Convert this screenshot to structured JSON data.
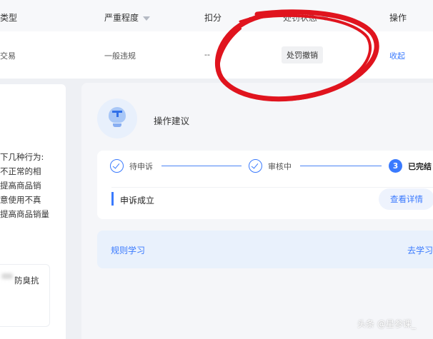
{
  "table": {
    "headers": {
      "type": "类型",
      "severity": "严重程度",
      "score": "扣分",
      "status": "处罚状态",
      "action": "操作"
    },
    "row": {
      "type": "交易",
      "severity": "一般违规",
      "score": "--",
      "status": "处罚撤销",
      "action": "收起"
    }
  },
  "left_panel": {
    "lines": [
      "下几种行为:",
      "不正常的相",
      "提高商品销",
      "意使用不真",
      "提高商品销量"
    ],
    "card_label": "防臭抗"
  },
  "suggestion": {
    "title": "操作建议",
    "steps": [
      {
        "label": "待申诉",
        "state": "done"
      },
      {
        "label": "审核中",
        "state": "done"
      },
      {
        "label": "已完结",
        "state": "current",
        "number": "3"
      }
    ],
    "result_label": "申诉成立",
    "detail_button": "查看详情"
  },
  "rules": {
    "label": "规则学习",
    "link": "去学习"
  },
  "annotation": {
    "color": "#e0141e"
  },
  "colors": {
    "accent": "#3a7afe"
  },
  "watermark": "头条 @星参课_"
}
